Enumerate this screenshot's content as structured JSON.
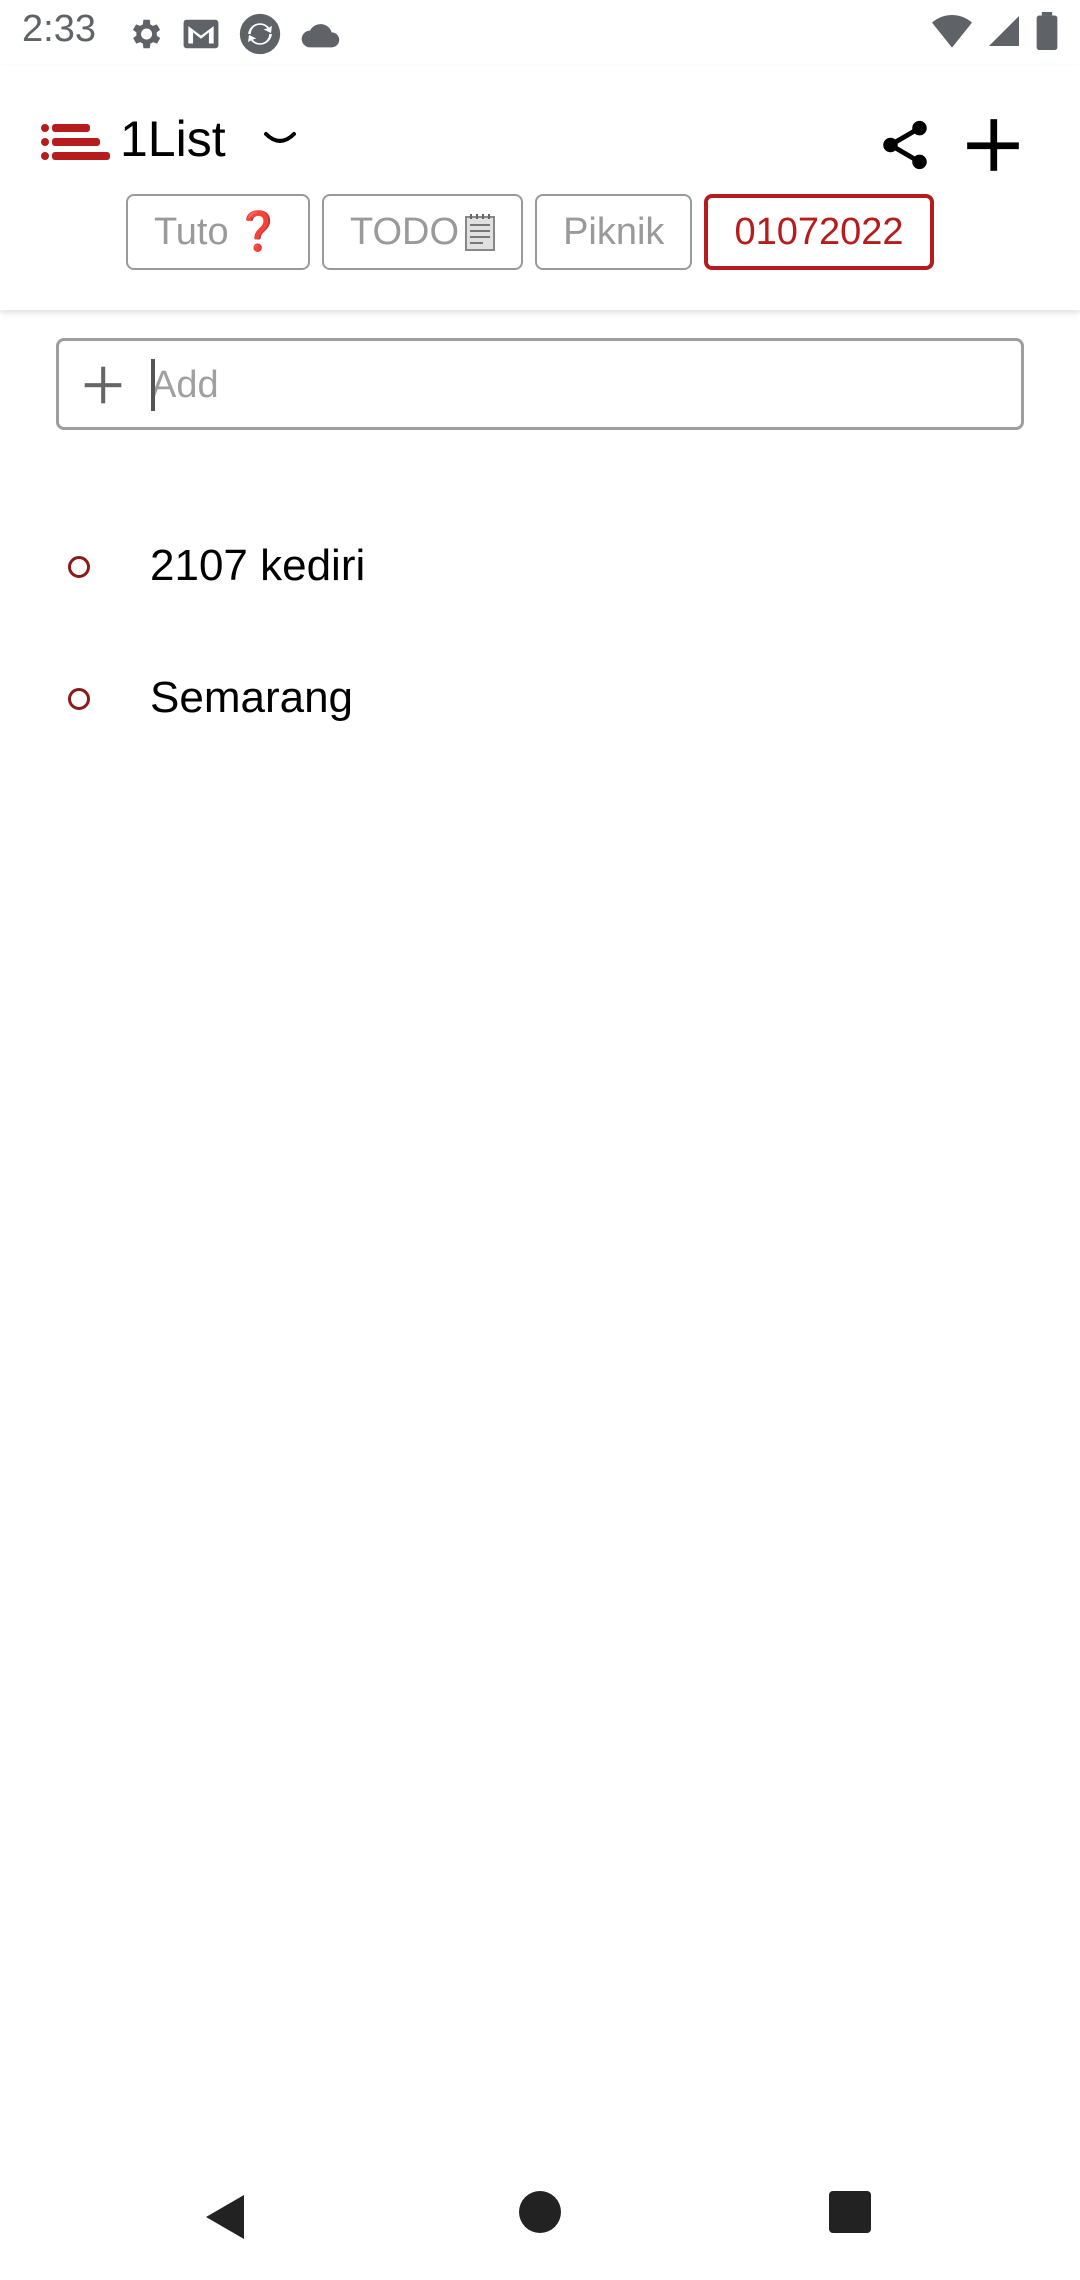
{
  "status_bar": {
    "time": "2:33",
    "left_icons": [
      "settings-icon",
      "gmail-icon",
      "sync-app-icon",
      "cloud-icon"
    ],
    "right_icons": [
      "wifi-icon",
      "cell-signal-icon",
      "battery-icon"
    ]
  },
  "header": {
    "title": "1List",
    "logo_icon": "list-logo-icon",
    "accent_color": "#b71c1c"
  },
  "tabs": [
    {
      "label": "Tuto",
      "emoji": "❓",
      "active": false
    },
    {
      "label": "TODO",
      "emoji": "notepad",
      "active": false
    },
    {
      "label": "Piknik",
      "emoji": "",
      "active": false
    },
    {
      "label": "01072022",
      "emoji": "",
      "active": true
    }
  ],
  "add_field": {
    "placeholder": "Add",
    "value": ""
  },
  "items": [
    {
      "text": "2107 kediri"
    },
    {
      "text": "Semarang"
    }
  ],
  "nav_bar": [
    "back-icon",
    "home-icon",
    "recents-icon"
  ]
}
